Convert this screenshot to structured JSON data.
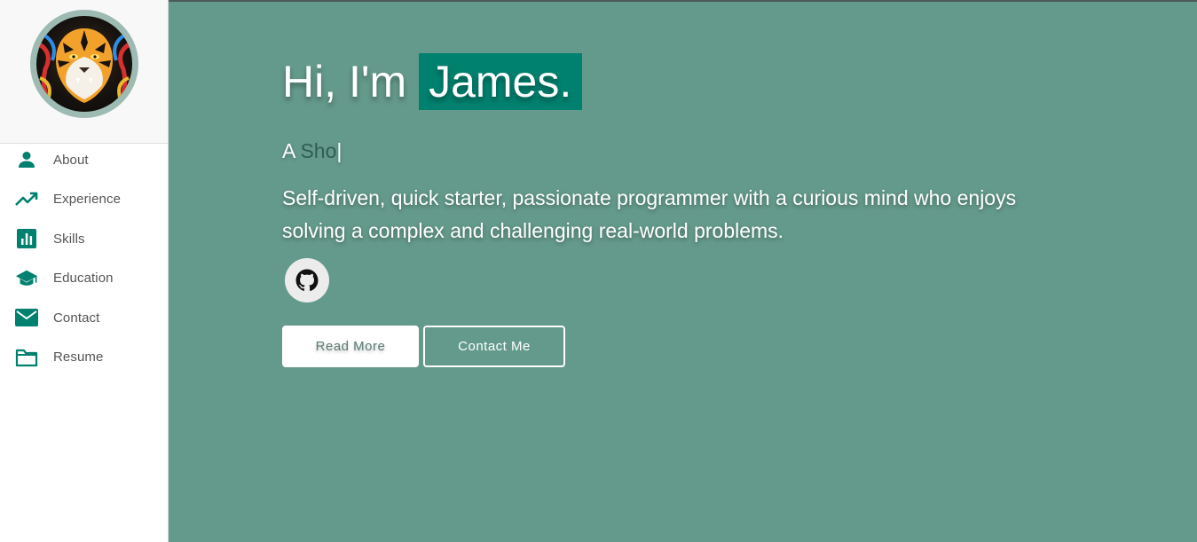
{
  "sidebar": {
    "avatar_alt": "Tiger profile picture",
    "items": [
      {
        "label": "About",
        "icon": "person-icon"
      },
      {
        "label": "Experience",
        "icon": "trending-up-icon"
      },
      {
        "label": "Skills",
        "icon": "bar-chart-icon"
      },
      {
        "label": "Education",
        "icon": "graduation-cap-icon"
      },
      {
        "label": "Contact",
        "icon": "mail-icon"
      },
      {
        "label": "Resume",
        "icon": "folder-icon"
      }
    ]
  },
  "hero": {
    "greeting": "Hi, I'm",
    "name": "James.",
    "typed_prefix": "A",
    "typed_word": "Sho",
    "typed_cursor": "|",
    "bio": "Self-driven, quick starter, passionate programmer with a curious mind who enjoys solving a complex and challenging real-world problems.",
    "social": [
      {
        "icon": "github-icon"
      }
    ],
    "read_more_label": "Read More",
    "contact_me_label": "Contact Me"
  },
  "colors": {
    "accent": "#00806e",
    "main_bg": "#649a8b",
    "icon_color": "#00806e"
  }
}
